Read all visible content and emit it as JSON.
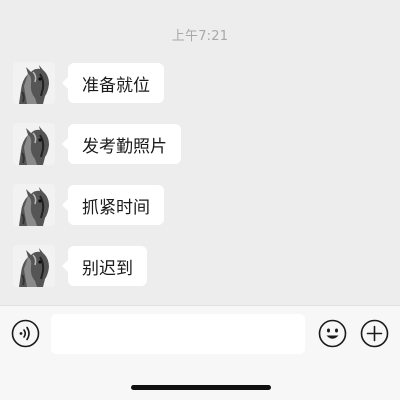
{
  "chat": {
    "timestamp": "上午7:21",
    "messages": [
      {
        "text": "准备就位"
      },
      {
        "text": "发考勤照片"
      },
      {
        "text": "抓紧时间"
      },
      {
        "text": "别迟到"
      }
    ]
  },
  "input_bar": {
    "text_value": "",
    "icons": {
      "voice": "voice-icon",
      "emoji": "emoji-icon",
      "more": "plus-icon"
    }
  },
  "colors": {
    "chat_background": "#ededed",
    "bubble": "#ffffff",
    "timestamp": "#a8a8a8",
    "input_bar": "#f7f7f7",
    "icon_stroke": "#1a1a1a"
  }
}
